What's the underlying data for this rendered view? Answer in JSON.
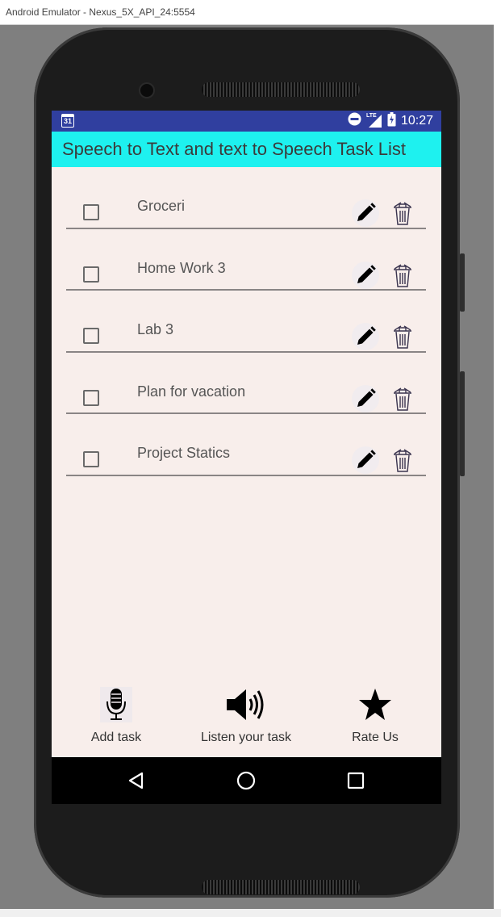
{
  "window": {
    "title": "Android Emulator - Nexus_5X_API_24:5554"
  },
  "status_bar": {
    "calendar_day": "31",
    "network": "LTE",
    "time": "10:27"
  },
  "app_bar": {
    "title": "Speech to Text and text to Speech Task List"
  },
  "tasks": [
    {
      "label": "Groceri",
      "checked": false
    },
    {
      "label": "Home Work 3",
      "checked": false
    },
    {
      "label": "Lab 3",
      "checked": false
    },
    {
      "label": "Plan for vacation",
      "checked": false
    },
    {
      "label": "Project Statics",
      "checked": false
    }
  ],
  "bottom_actions": {
    "add_task": {
      "label": "Add task",
      "icon": "microphone-icon"
    },
    "listen": {
      "label": "Listen your task",
      "icon": "speaker-icon"
    },
    "rate": {
      "label": "Rate Us",
      "icon": "star-icon"
    }
  },
  "nav_bar": {
    "back_icon": "back-triangle-icon",
    "home_icon": "home-circle-icon",
    "recents_icon": "recents-square-icon"
  },
  "colors": {
    "status_bar": "#303f9f",
    "app_bar": "#1ef1ef",
    "screen_bg": "#f8eeeb"
  }
}
